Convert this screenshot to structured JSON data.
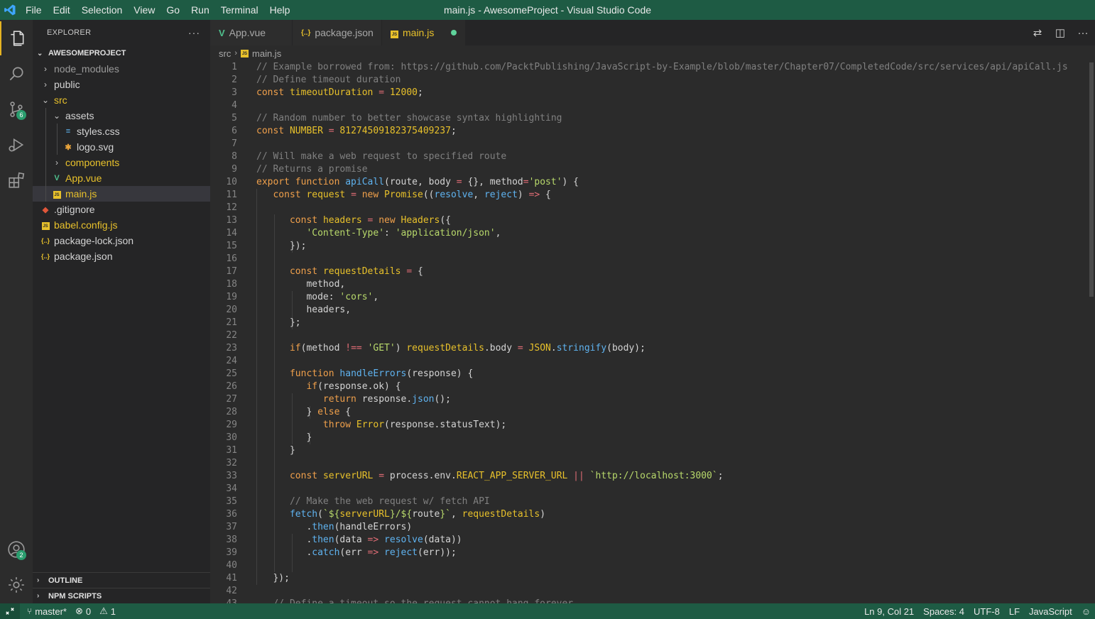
{
  "window": {
    "title": "main.js - AwesomeProject - Visual Studio Code"
  },
  "menu": [
    "File",
    "Edit",
    "Selection",
    "View",
    "Go",
    "Run",
    "Terminal",
    "Help"
  ],
  "activity": {
    "scm_badge": "6",
    "accounts_badge": "2"
  },
  "sidebar": {
    "title": "EXPLORER",
    "more": "···",
    "project": "AWESOMEPROJECT",
    "tree": [
      {
        "label": "node_modules",
        "depth": 0,
        "kind": "folder-closed",
        "dim": true
      },
      {
        "label": "public",
        "depth": 0,
        "kind": "folder-closed"
      },
      {
        "label": "src",
        "depth": 0,
        "kind": "folder-open",
        "color": "#e8c12b"
      },
      {
        "label": "assets",
        "depth": 1,
        "kind": "folder-open"
      },
      {
        "label": "styles.css",
        "depth": 2,
        "kind": "css"
      },
      {
        "label": "logo.svg",
        "depth": 2,
        "kind": "svg"
      },
      {
        "label": "components",
        "depth": 1,
        "kind": "folder-closed",
        "color": "#e8c12b"
      },
      {
        "label": "App.vue",
        "depth": 1,
        "kind": "vue",
        "color": "#e8c12b"
      },
      {
        "label": "main.js",
        "depth": 1,
        "kind": "js",
        "color": "#e8c12b",
        "selected": true
      },
      {
        "label": ".gitignore",
        "depth": 0,
        "kind": "git"
      },
      {
        "label": "babel.config.js",
        "depth": 0,
        "kind": "js",
        "color": "#e8c12b"
      },
      {
        "label": "package-lock.json",
        "depth": 0,
        "kind": "json"
      },
      {
        "label": "package.json",
        "depth": 0,
        "kind": "json"
      }
    ],
    "outline": "OUTLINE",
    "npm_scripts": "NPM SCRIPTS"
  },
  "tabs": [
    {
      "label": "App.vue",
      "kind": "vue"
    },
    {
      "label": "package.json",
      "kind": "json"
    },
    {
      "label": "main.js",
      "kind": "js",
      "active": true,
      "dirty": true
    }
  ],
  "breadcrumb": {
    "folder": "src",
    "file": "main.js"
  },
  "code_lines": [
    [
      [
        "c",
        "// Example borrowed from: https://github.com/PacktPublishing/JavaScript-by-Example/blob/master/Chapter07/CompletedCode/src/services/api/apiCall.js"
      ]
    ],
    [
      [
        "c",
        "// Define timeout duration"
      ]
    ],
    [
      [
        "k",
        "const "
      ],
      [
        "con",
        "timeoutDuration"
      ],
      [
        "o",
        " = "
      ],
      [
        "n",
        "12000"
      ],
      [
        "p",
        ";"
      ]
    ],
    [],
    [
      [
        "c",
        "// Random number to better showcase syntax highlighting"
      ]
    ],
    [
      [
        "k",
        "const "
      ],
      [
        "con",
        "NUMBER"
      ],
      [
        "o",
        " = "
      ],
      [
        "n",
        "81274509182375409237"
      ],
      [
        "p",
        ";"
      ]
    ],
    [],
    [
      [
        "c",
        "// Will make a web request to specified route"
      ]
    ],
    [
      [
        "c",
        "// Returns a promise"
      ]
    ],
    [
      [
        "k",
        "export function "
      ],
      [
        "f",
        "apiCall"
      ],
      [
        "p",
        "("
      ],
      [
        "v",
        "route"
      ],
      [
        "p",
        ", "
      ],
      [
        "v",
        "body"
      ],
      [
        "o",
        " = "
      ],
      [
        "p",
        "{}, "
      ],
      [
        "v",
        "method"
      ],
      [
        "o",
        "="
      ],
      [
        "s",
        "'post'"
      ],
      [
        "p",
        ") {"
      ]
    ],
    [
      [
        "p",
        "   "
      ],
      [
        "k",
        "const "
      ],
      [
        "con",
        "request"
      ],
      [
        "o",
        " = "
      ],
      [
        "k",
        "new "
      ],
      [
        "cls",
        "Promise"
      ],
      [
        "p",
        "(("
      ],
      [
        "f",
        "resolve"
      ],
      [
        "p",
        ", "
      ],
      [
        "f",
        "reject"
      ],
      [
        "p",
        ") "
      ],
      [
        "o",
        "=>"
      ],
      [
        "p",
        " {"
      ]
    ],
    [],
    [
      [
        "p",
        "      "
      ],
      [
        "k",
        "const "
      ],
      [
        "con",
        "headers"
      ],
      [
        "o",
        " = "
      ],
      [
        "k",
        "new "
      ],
      [
        "cls",
        "Headers"
      ],
      [
        "p",
        "({"
      ]
    ],
    [
      [
        "p",
        "         "
      ],
      [
        "s",
        "'Content-Type'"
      ],
      [
        "p",
        ": "
      ],
      [
        "s",
        "'application/json'"
      ],
      [
        "p",
        ","
      ]
    ],
    [
      [
        "p",
        "      });"
      ]
    ],
    [],
    [
      [
        "p",
        "      "
      ],
      [
        "k",
        "const "
      ],
      [
        "con",
        "requestDetails"
      ],
      [
        "o",
        " = "
      ],
      [
        "p",
        "{"
      ]
    ],
    [
      [
        "p",
        "         "
      ],
      [
        "v",
        "method"
      ],
      [
        "p",
        ","
      ]
    ],
    [
      [
        "p",
        "         "
      ],
      [
        "v",
        "mode"
      ],
      [
        "p",
        ": "
      ],
      [
        "s",
        "'cors'"
      ],
      [
        "p",
        ","
      ]
    ],
    [
      [
        "p",
        "         "
      ],
      [
        "v",
        "headers"
      ],
      [
        "p",
        ","
      ]
    ],
    [
      [
        "p",
        "      };"
      ]
    ],
    [],
    [
      [
        "p",
        "      "
      ],
      [
        "k",
        "if"
      ],
      [
        "p",
        "("
      ],
      [
        "v",
        "method"
      ],
      [
        "o",
        " !== "
      ],
      [
        "s",
        "'GET'"
      ],
      [
        "p",
        ") "
      ],
      [
        "con",
        "requestDetails"
      ],
      [
        "p",
        "."
      ],
      [
        "v",
        "body"
      ],
      [
        "o",
        " = "
      ],
      [
        "cls",
        "JSON"
      ],
      [
        "p",
        "."
      ],
      [
        "f",
        "stringify"
      ],
      [
        "p",
        "("
      ],
      [
        "v",
        "body"
      ],
      [
        "p",
        ");"
      ]
    ],
    [],
    [
      [
        "p",
        "      "
      ],
      [
        "k",
        "function "
      ],
      [
        "f",
        "handleErrors"
      ],
      [
        "p",
        "("
      ],
      [
        "v",
        "response"
      ],
      [
        "p",
        ") {"
      ]
    ],
    [
      [
        "p",
        "         "
      ],
      [
        "k",
        "if"
      ],
      [
        "p",
        "("
      ],
      [
        "v",
        "response"
      ],
      [
        "p",
        "."
      ],
      [
        "v",
        "ok"
      ],
      [
        "p",
        ") {"
      ]
    ],
    [
      [
        "p",
        "            "
      ],
      [
        "k",
        "return "
      ],
      [
        "v",
        "response"
      ],
      [
        "p",
        "."
      ],
      [
        "f",
        "json"
      ],
      [
        "p",
        "();"
      ]
    ],
    [
      [
        "p",
        "         } "
      ],
      [
        "k",
        "else"
      ],
      [
        "p",
        " {"
      ]
    ],
    [
      [
        "p",
        "            "
      ],
      [
        "k",
        "throw "
      ],
      [
        "cls",
        "Error"
      ],
      [
        "p",
        "("
      ],
      [
        "v",
        "response"
      ],
      [
        "p",
        "."
      ],
      [
        "v",
        "statusText"
      ],
      [
        "p",
        ");"
      ]
    ],
    [
      [
        "p",
        "         }"
      ]
    ],
    [
      [
        "p",
        "      }"
      ]
    ],
    [],
    [
      [
        "p",
        "      "
      ],
      [
        "k",
        "const "
      ],
      [
        "con",
        "serverURL"
      ],
      [
        "o",
        " = "
      ],
      [
        "v",
        "process"
      ],
      [
        "p",
        "."
      ],
      [
        "v",
        "env"
      ],
      [
        "p",
        "."
      ],
      [
        "con",
        "REACT_APP_SERVER_URL"
      ],
      [
        "o",
        " || "
      ],
      [
        "s",
        "`http://localhost:3000`"
      ],
      [
        "p",
        ";"
      ]
    ],
    [],
    [
      [
        "p",
        "      "
      ],
      [
        "c",
        "// Make the web request w/ fetch API"
      ]
    ],
    [
      [
        "p",
        "      "
      ],
      [
        "f",
        "fetch"
      ],
      [
        "p",
        "("
      ],
      [
        "s",
        "`${"
      ],
      [
        "con",
        "serverURL"
      ],
      [
        "s",
        "}/${"
      ],
      [
        "v",
        "route"
      ],
      [
        "s",
        "}`"
      ],
      [
        "p",
        ", "
      ],
      [
        "con",
        "requestDetails"
      ],
      [
        "p",
        ")"
      ]
    ],
    [
      [
        "p",
        "         ."
      ],
      [
        "f",
        "then"
      ],
      [
        "p",
        "("
      ],
      [
        "v",
        "handleErrors"
      ],
      [
        "p",
        ")"
      ]
    ],
    [
      [
        "p",
        "         ."
      ],
      [
        "f",
        "then"
      ],
      [
        "p",
        "("
      ],
      [
        "v",
        "data"
      ],
      [
        "o",
        " => "
      ],
      [
        "f",
        "resolve"
      ],
      [
        "p",
        "("
      ],
      [
        "v",
        "data"
      ],
      [
        "p",
        "))"
      ]
    ],
    [
      [
        "p",
        "         ."
      ],
      [
        "f",
        "catch"
      ],
      [
        "p",
        "("
      ],
      [
        "v",
        "err"
      ],
      [
        "o",
        " => "
      ],
      [
        "f",
        "reject"
      ],
      [
        "p",
        "("
      ],
      [
        "v",
        "err"
      ],
      [
        "p",
        "));"
      ]
    ],
    [],
    [
      [
        "p",
        "   });"
      ]
    ],
    [],
    [
      [
        "p",
        "   "
      ],
      [
        "c",
        "// Define a timeout so the request cannot hang forever"
      ]
    ]
  ],
  "status": {
    "branch": "master*",
    "errors": "0",
    "warnings": "1",
    "position": "Ln 9, Col 21",
    "spaces": "Spaces: 4",
    "encoding": "UTF-8",
    "eol": "LF",
    "language": "JavaScript"
  },
  "colors": {
    "titlebar": "#1e5b44",
    "statusbar": "#1e5b44",
    "accent": "#e6b422",
    "badge": "#2a9d6e"
  }
}
